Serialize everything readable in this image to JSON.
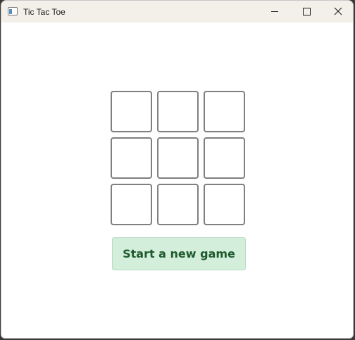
{
  "window": {
    "title": "Tic Tac Toe",
    "controls": {
      "minimize_icon": "minimize-icon",
      "maximize_icon": "maximize-icon",
      "close_icon": "close-icon"
    }
  },
  "board": {
    "cells": [
      "",
      "",
      "",
      "",
      "",
      "",
      "",
      "",
      ""
    ]
  },
  "actions": {
    "new_game_label": "Start a new game"
  },
  "colors": {
    "button_bg": "#d3eedb",
    "button_text": "#1f5a2e",
    "cell_border": "#7f7f7f",
    "titlebar_bg": "#f3f0ea"
  }
}
